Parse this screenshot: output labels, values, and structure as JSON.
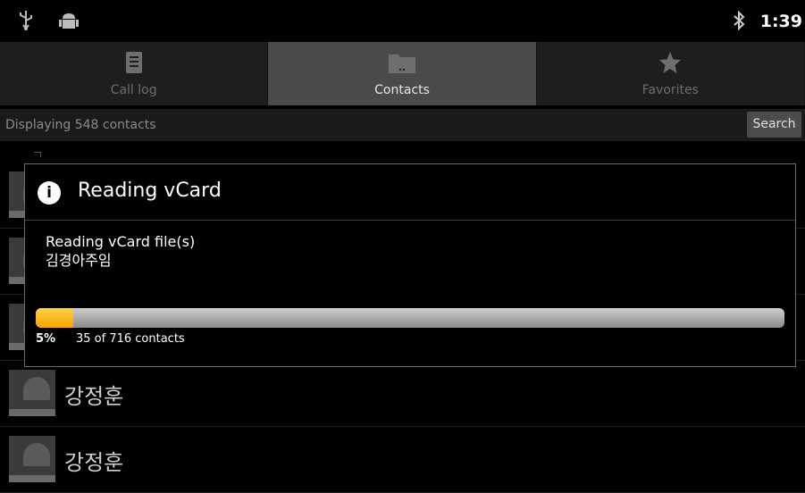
{
  "status_bar": {
    "time": "1:39",
    "icons": [
      "usb-icon",
      "android-debug-icon",
      "bluetooth-icon"
    ]
  },
  "tabs": [
    {
      "label": "Call log",
      "icon": "call-log-icon",
      "active": false
    },
    {
      "label": "Contacts",
      "icon": "contacts-folder-icon",
      "active": true
    },
    {
      "label": "Favorites",
      "icon": "star-icon",
      "active": false
    }
  ],
  "subheader": {
    "text": "Displaying 548 contacts",
    "search_label": "Search"
  },
  "contacts": [
    {
      "name": ""
    },
    {
      "name": ""
    },
    {
      "name": ""
    },
    {
      "name": "강정훈"
    },
    {
      "name": "강정훈"
    }
  ],
  "dialog": {
    "title": "Reading vCard",
    "message_line1": "Reading vCard file(s)",
    "message_line2": "김경아주임",
    "progress_percent": "5%",
    "progress_fraction": 0.05,
    "progress_count": "35 of 716 contacts"
  },
  "colors": {
    "progress_fill": "#f5b400",
    "active_tab": "#4a4a4a"
  }
}
